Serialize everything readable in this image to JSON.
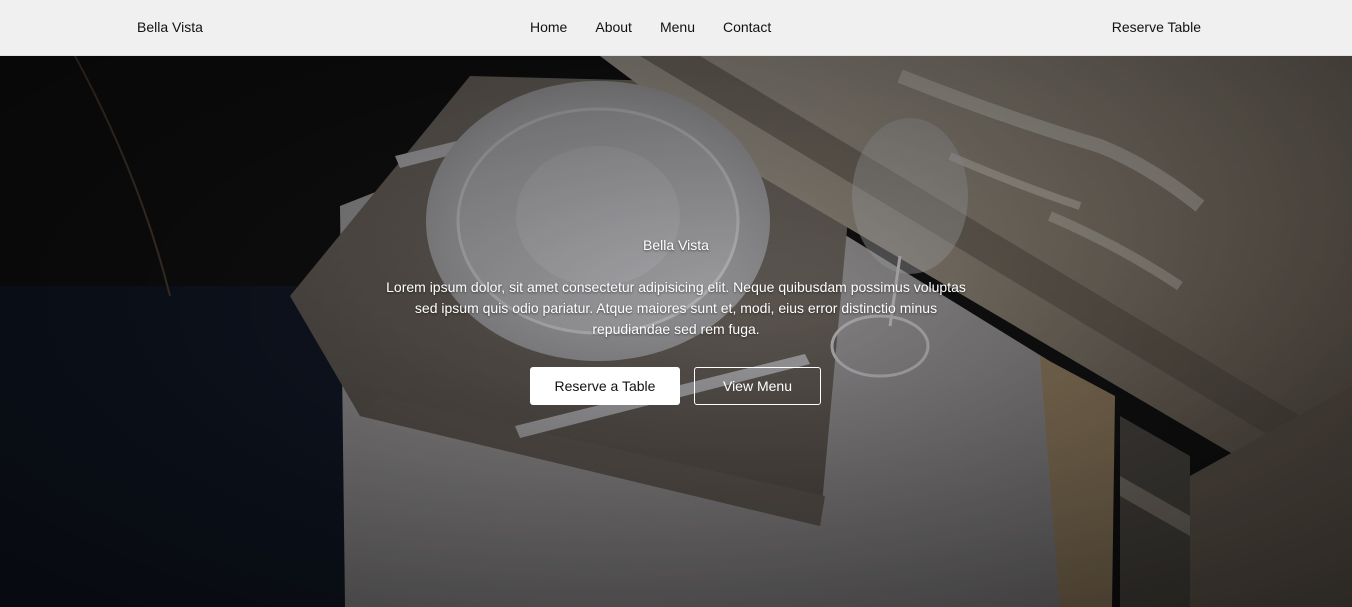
{
  "navbar": {
    "brand": "Bella Vista",
    "links": [
      "Home",
      "About",
      "Menu",
      "Contact"
    ],
    "cta": "Reserve Table"
  },
  "hero": {
    "title": "Bella Vista",
    "text": "Lorem ipsum dolor, sit amet consectetur adipisicing elit. Neque quibusdam possimus voluptas sed ipsum quis odio pariatur. Atque maiores sunt et, modi, eius error distinctio minus repudiandae sed rem fuga.",
    "primary_button": "Reserve a Table",
    "secondary_button": "View Menu"
  },
  "colors": {
    "nav_background": "#f8f8f8",
    "text_dark": "#111111",
    "text_light": "#ffffff"
  }
}
